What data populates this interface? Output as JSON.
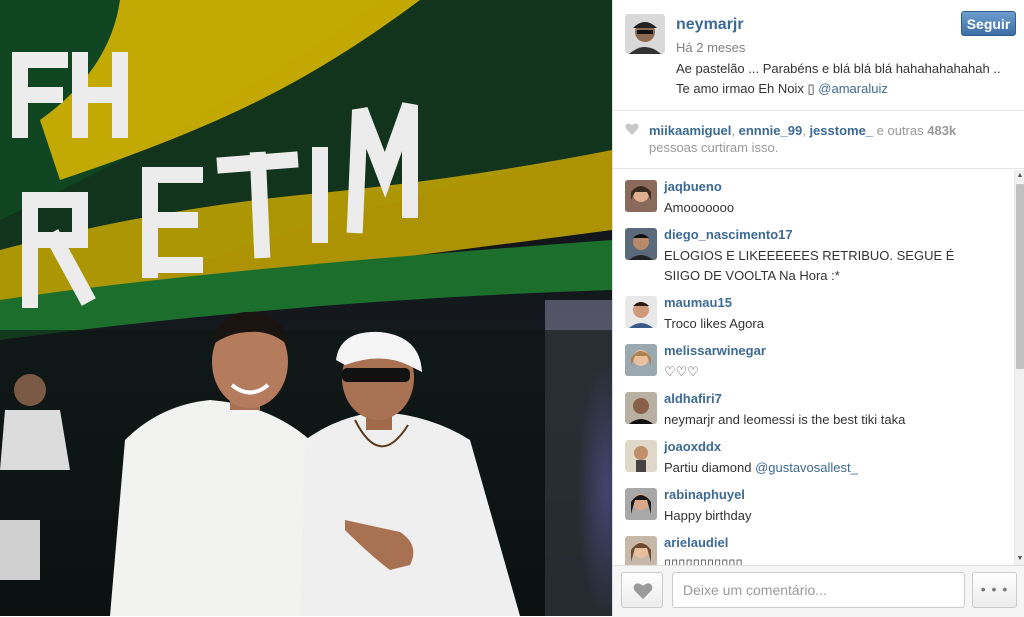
{
  "post": {
    "username": "neymarjr",
    "time": "Há 2 meses",
    "follow_label": "Seguir",
    "caption_line1": "Ae pastelão ... Parabéns e blá blá blá hahahahahahah ..",
    "caption_line2_prefix": "Te amo irmao Eh Noix ",
    "caption_emoji": "▯",
    "caption_mention": "@amaraluiz",
    "photo_banner_text": "EH RETIM"
  },
  "likes": {
    "user1": "miikaamiguel",
    "sep1": ", ",
    "user2": "ennnie_99",
    "sep2": ", ",
    "user3": "jesstome_",
    "others_prefix": " e outras ",
    "count": "483k",
    "suffix": "pessoas curtiram isso."
  },
  "comments": [
    {
      "user": "jaqbueno",
      "text": "Amooooooo",
      "mention": ""
    },
    {
      "user": "diego_nascimento17",
      "text": "ELOGIOS E LIKEEEEEES RETRIBUO. SEGUE É SIIGO DE VOOLTA Na Hora :*",
      "mention": ""
    },
    {
      "user": "maumau15",
      "text": "Troco likes Agora",
      "mention": ""
    },
    {
      "user": "melissarwinegar",
      "text": "♡♡♡",
      "mention": ""
    },
    {
      "user": "aldhafiri7",
      "text": "neymarjr and leomessi is the best tiki taka",
      "mention": ""
    },
    {
      "user": "joaoxddx",
      "text": "Partiu diamond ",
      "mention": "@gustavosallest_"
    },
    {
      "user": "rabinaphuyel",
      "text": "Happy birthday",
      "mention": ""
    },
    {
      "user": "arielaudiel",
      "text": "▯▯▯▯▯▯▯▯▯▯▯",
      "mention": ""
    }
  ],
  "footer": {
    "comment_placeholder": "Deixe um comentário...",
    "more_label": "• • •"
  },
  "colors": {
    "link": "#3d6a94",
    "follow_button": "#4a7bb0",
    "photo_banner_yellow": "#e8c000",
    "photo_banner_green": "#1a6a2a"
  },
  "icons": {
    "like": "heart-icon",
    "more": "ellipsis-icon",
    "scroll_up": "triangle-up-icon",
    "scroll_down": "triangle-down-icon"
  }
}
